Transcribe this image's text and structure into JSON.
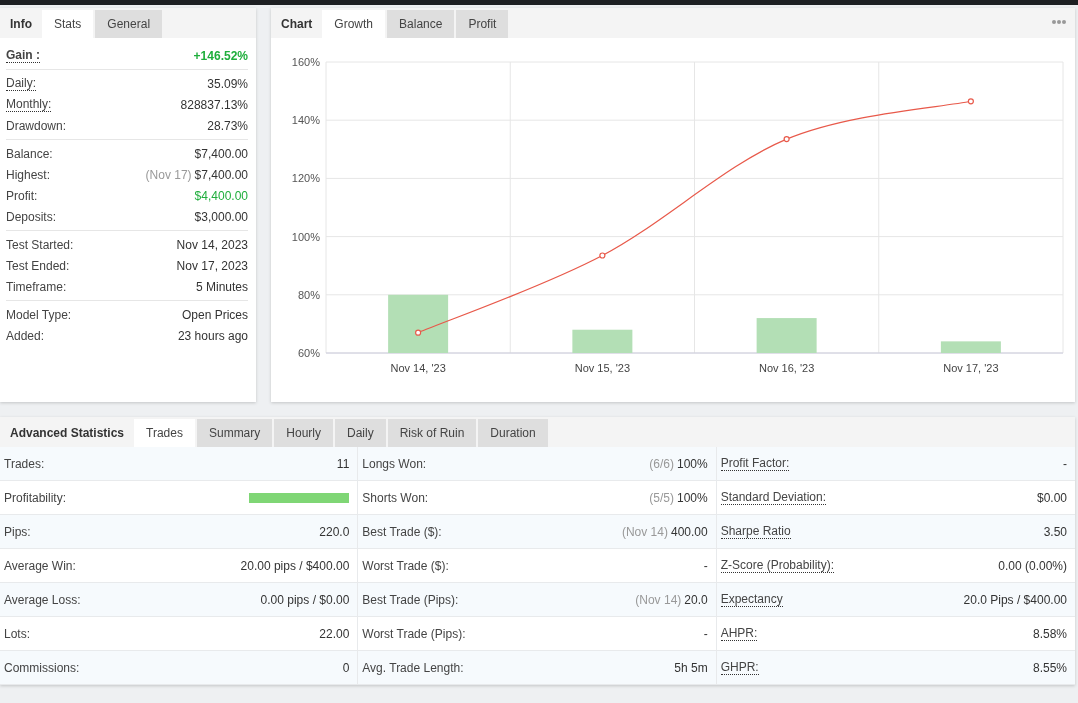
{
  "info": {
    "title": "Info",
    "tabs": [
      {
        "label": "Stats",
        "selected": true
      },
      {
        "label": "General",
        "selected": false
      }
    ],
    "groups": [
      {
        "rows": [
          {
            "label": "Gain :",
            "value": "+146.52%",
            "dotted": true,
            "bold": true,
            "positive": true
          }
        ]
      },
      {
        "rows": [
          {
            "label": "Daily:",
            "value": "35.09%",
            "dotted": true,
            "bold": false,
            "positive": false
          },
          {
            "label": "Monthly:",
            "value": "828837.13%",
            "dotted": true,
            "bold": false,
            "positive": false
          },
          {
            "label": "Drawdown:",
            "value": "28.73%",
            "dotted": false,
            "bold": false,
            "positive": false
          }
        ]
      },
      {
        "rows": [
          {
            "label": "Balance:",
            "value": "$7,400.00",
            "dotted": false,
            "bold": false,
            "positive": false
          },
          {
            "label": "Highest:",
            "note": "(Nov 17)",
            "value": "$7,400.00",
            "dotted": false,
            "bold": false,
            "positive": false
          },
          {
            "label": "Profit:",
            "value": "$4,400.00",
            "dotted": false,
            "bold": false,
            "positive": true
          },
          {
            "label": "Deposits:",
            "value": "$3,000.00",
            "dotted": false,
            "bold": false,
            "positive": false
          }
        ]
      },
      {
        "rows": [
          {
            "label": "Test Started:",
            "value": "Nov 14, 2023",
            "dotted": false,
            "bold": false,
            "positive": false
          },
          {
            "label": "Test Ended:",
            "value": "Nov 17, 2023",
            "dotted": false,
            "bold": false,
            "positive": false
          },
          {
            "label": "Timeframe:",
            "value": "5 Minutes",
            "dotted": false,
            "bold": false,
            "positive": false
          }
        ]
      },
      {
        "rows": [
          {
            "label": "Model Type:",
            "value": "Open Prices",
            "dotted": false,
            "bold": false,
            "positive": false
          },
          {
            "label": "Added:",
            "value": "23 hours ago",
            "dotted": false,
            "bold": false,
            "positive": false
          }
        ]
      }
    ]
  },
  "chart": {
    "title": "Chart",
    "tabs": [
      {
        "label": "Growth",
        "selected": true
      },
      {
        "label": "Balance",
        "selected": false
      },
      {
        "label": "Profit",
        "selected": false
      }
    ],
    "chart_data": {
      "type": "line",
      "categories": [
        "Nov 14, '23",
        "Nov 15, '23",
        "Nov 16, '23",
        "Nov 17, '23"
      ],
      "ylim": [
        60,
        160
      ],
      "yticks": [
        {
          "value": 60,
          "label": "60%"
        },
        {
          "value": 80,
          "label": "80%"
        },
        {
          "value": 100,
          "label": "100%"
        },
        {
          "value": 120,
          "label": "120%"
        },
        {
          "value": 140,
          "label": "140%"
        },
        {
          "value": 160,
          "label": "160%"
        }
      ],
      "grid": true,
      "series": [
        {
          "type": "bar",
          "color": "#b3dfb5",
          "values": [
            80,
            68,
            72,
            64
          ]
        },
        {
          "color": "#e8594a",
          "marker": true,
          "values": [
            67,
            93.5,
            133.5,
            146.5
          ]
        }
      ]
    }
  },
  "advanced": {
    "title": "Advanced Statistics",
    "tabs": [
      {
        "label": "Trades",
        "selected": true
      },
      {
        "label": "Summary",
        "selected": false
      },
      {
        "label": "Hourly",
        "selected": false
      },
      {
        "label": "Daily",
        "selected": false
      },
      {
        "label": "Risk of Ruin",
        "selected": false
      },
      {
        "label": "Duration",
        "selected": false
      }
    ],
    "rows": [
      [
        {
          "label": "Trades:",
          "value": "11",
          "dotted": false
        },
        {
          "label": "Longs Won:",
          "note": "(6/6)",
          "value": "100%",
          "dotted": false
        },
        {
          "label": "Profit Factor:",
          "value": "-",
          "dotted": true
        }
      ],
      [
        {
          "label": "Profitability:",
          "kind": "bar",
          "level": 1,
          "dotted": false
        },
        {
          "label": "Shorts Won:",
          "note": "(5/5)",
          "value": "100%",
          "dotted": false
        },
        {
          "label": "Standard Deviation:",
          "value": "$0.00",
          "dotted": true
        }
      ],
      [
        {
          "label": "Pips:",
          "value": "220.0",
          "dotted": false
        },
        {
          "label": "Best Trade ($):",
          "note": "(Nov 14)",
          "value": "400.00",
          "dotted": false
        },
        {
          "label": "Sharpe Ratio",
          "value": "3.50",
          "dotted": true
        }
      ],
      [
        {
          "label": "Average Win:",
          "value": "20.00 pips / $400.00",
          "dotted": false
        },
        {
          "label": "Worst Trade ($):",
          "value": "-",
          "dotted": false
        },
        {
          "label": "Z-Score (Probability):",
          "value": "0.00 (0.00%)",
          "dotted": true
        }
      ],
      [
        {
          "label": "Average Loss:",
          "value": "0.00 pips / $0.00",
          "dotted": false
        },
        {
          "label": "Best Trade (Pips):",
          "note": "(Nov 14)",
          "value": "20.0",
          "dotted": false
        },
        {
          "label": "Expectancy",
          "value": "20.0 Pips / $400.00",
          "dotted": true
        }
      ],
      [
        {
          "label": "Lots:",
          "value": "22.00",
          "dotted": false
        },
        {
          "label": "Worst Trade (Pips):",
          "value": "-",
          "dotted": false
        },
        {
          "label": "AHPR:",
          "value": "8.58%",
          "dotted": true
        }
      ],
      [
        {
          "label": "Commissions:",
          "value": "0",
          "dotted": false
        },
        {
          "label": "Avg. Trade Length:",
          "value": "5h 5m",
          "dotted": false
        },
        {
          "label": "GHPR:",
          "value": "8.55%",
          "dotted": true
        }
      ]
    ]
  }
}
